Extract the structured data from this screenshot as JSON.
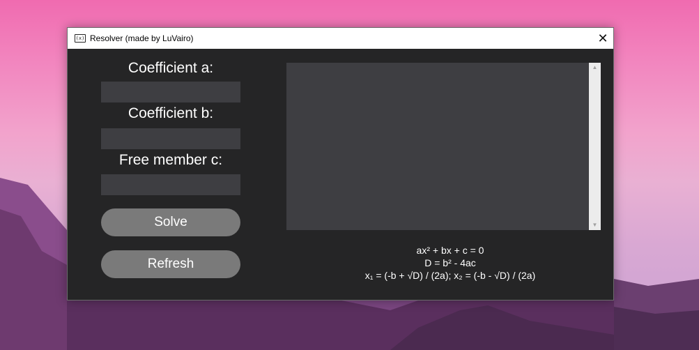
{
  "window": {
    "title": "Resolver (made by LuVairo)",
    "icon": "(x)",
    "close": "✕"
  },
  "form": {
    "label_a": "Coefficient a:",
    "label_b": "Coefficient b:",
    "label_c": "Free member c:",
    "value_a": "",
    "value_b": "",
    "value_c": "",
    "solve": "Solve",
    "refresh": "Refresh"
  },
  "output": {
    "text": "",
    "scroll_up": "▲",
    "scroll_down": "▼"
  },
  "formulas": {
    "line1": "ax² + bx + c = 0",
    "line2": "D = b² - 4ac",
    "line3": "x₁ = (-b + √D) / (2a); x₂ = (-b - √D) / (2a)"
  },
  "colors": {
    "window_bg": "#252526",
    "field_bg": "#3e3e42",
    "button_bg": "#7a7a7a"
  }
}
